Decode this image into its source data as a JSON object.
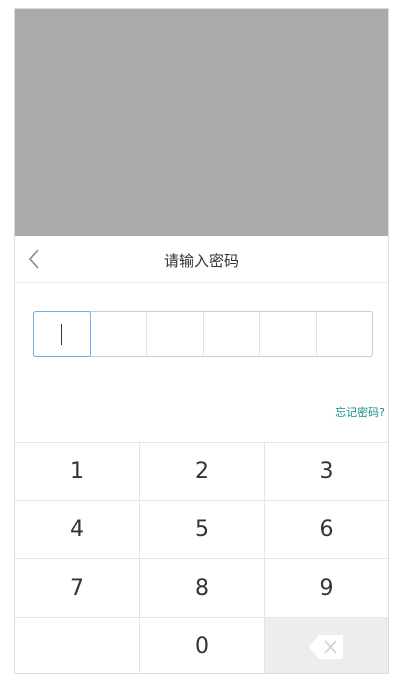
{
  "dialog": {
    "title": "请输入密码",
    "forgot_link": "忘记密码?"
  },
  "pin": {
    "length": 6,
    "filled": 0
  },
  "keypad": {
    "keys": [
      "1",
      "2",
      "3",
      "4",
      "5",
      "6",
      "7",
      "8",
      "9",
      "",
      "0",
      "⌫"
    ]
  },
  "colors": {
    "overlay": "#aaaaaa",
    "active_cell_border": "#6cb0e8",
    "link": "#1a8c7f",
    "delete_key_bg": "#ededed"
  },
  "icons": {
    "back": "chevron-left-icon",
    "delete": "backspace-icon"
  }
}
